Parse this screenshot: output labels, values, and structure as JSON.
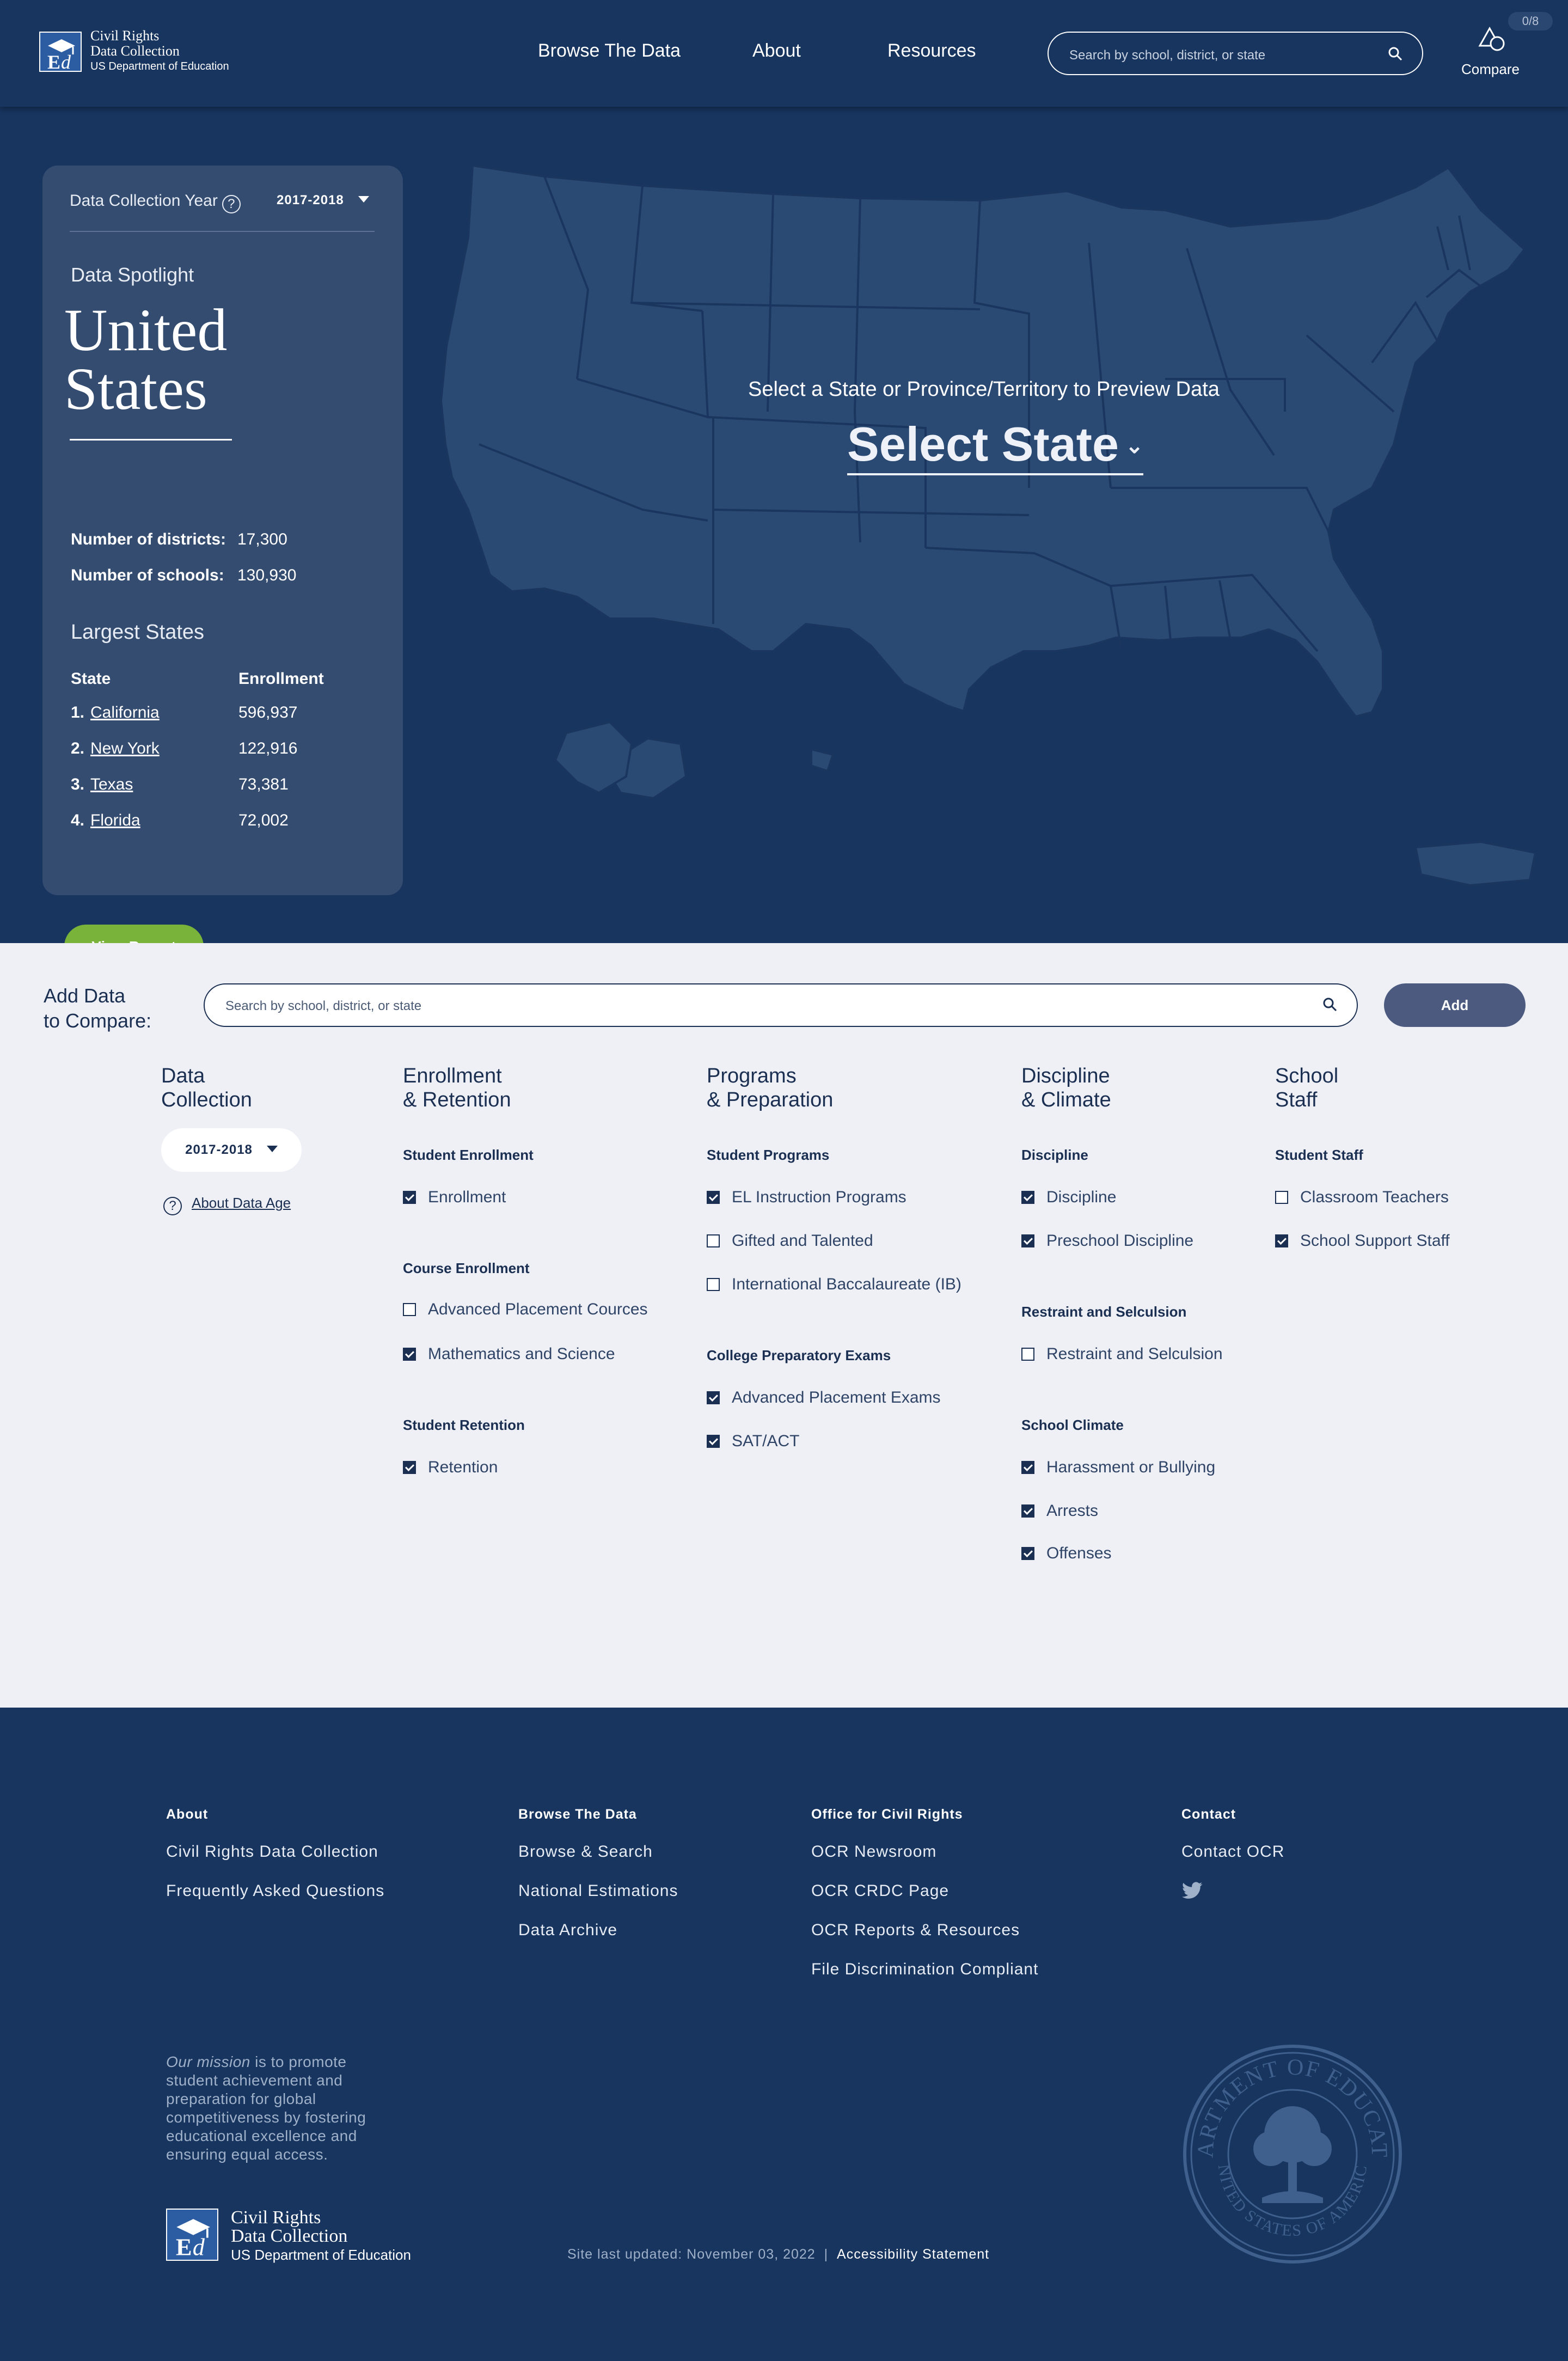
{
  "header": {
    "logo": {
      "line1": "Civil Rights",
      "line2": "Data Collection",
      "line3": "US Department of Education"
    },
    "nav": [
      "Browse The Data",
      "About",
      "Resources"
    ],
    "search_placeholder": "Search by school, district, or state",
    "compare_count": "0/8",
    "compare_label": "Compare"
  },
  "spotlight": {
    "year_label": "Data Collection Year",
    "year_value": "2017-2018",
    "section_label": "Data Spotlight",
    "title_line1": "United",
    "title_line2": "States",
    "stats": [
      {
        "label": "Number of districts:",
        "value": "17,300"
      },
      {
        "label": "Number of schools:",
        "value": "130,930"
      }
    ],
    "largest_label": "Largest States",
    "col_state": "State",
    "col_enrollment": "Enrollment",
    "rows": [
      {
        "rank": "1.",
        "state": "California",
        "enrollment": "596,937"
      },
      {
        "rank": "2.",
        "state": "New York",
        "enrollment": "122,916"
      },
      {
        "rank": "3.",
        "state": "Texas",
        "enrollment": "73,381"
      },
      {
        "rank": "4.",
        "state": "Florida",
        "enrollment": "72,002"
      }
    ],
    "view_button": "View Report"
  },
  "map": {
    "prompt": "Select a State or Province/Territory to Preview Data",
    "select_label": "Select State"
  },
  "compare": {
    "title_line1": "Add Data",
    "title_line2": "to Compare:",
    "search_placeholder": "Search by school, district, or state",
    "add_button": "Add",
    "data_collection": {
      "head1": "Data",
      "head2": "Collection",
      "year": "2017-2018",
      "about_link": "About Data Age"
    },
    "enrollment": {
      "head1": "Enrollment",
      "head2": "& Retention",
      "groups": [
        {
          "title": "Student Enrollment",
          "items": [
            {
              "label": "Enrollment",
              "checked": true
            }
          ]
        },
        {
          "title": "Course Enrollment",
          "items": [
            {
              "label": "Advanced Placement Cources",
              "checked": false
            },
            {
              "label": "Mathematics and Science",
              "checked": true
            }
          ]
        },
        {
          "title": "Student Retention",
          "items": [
            {
              "label": "Retention",
              "checked": true
            }
          ]
        }
      ]
    },
    "programs": {
      "head1": "Programs",
      "head2": "& Preparation",
      "groups": [
        {
          "title": "Student Programs",
          "items": [
            {
              "label": "EL Instruction Programs",
              "checked": true
            },
            {
              "label": "Gifted and Talented",
              "checked": false
            },
            {
              "label": "International Baccalaureate (IB)",
              "checked": false
            }
          ]
        },
        {
          "title": "College Preparatory Exams",
          "items": [
            {
              "label": "Advanced Placement Exams",
              "checked": true
            },
            {
              "label": "SAT/ACT",
              "checked": true
            }
          ]
        }
      ]
    },
    "discipline": {
      "head1": "Discipline",
      "head2": "& Climate",
      "groups": [
        {
          "title": "Discipline",
          "items": [
            {
              "label": "Discipline",
              "checked": true
            },
            {
              "label": "Preschool Discipline",
              "checked": true
            }
          ]
        },
        {
          "title": "Restraint and Selculsion",
          "items": [
            {
              "label": "Restraint and Selculsion",
              "checked": false
            }
          ]
        },
        {
          "title": "School Climate",
          "items": [
            {
              "label": "Harassment or Bullying",
              "checked": true
            },
            {
              "label": "Arrests",
              "checked": true
            },
            {
              "label": "Offenses",
              "checked": true
            }
          ]
        }
      ]
    },
    "staff": {
      "head1": "School",
      "head2": "Staff",
      "groups": [
        {
          "title": "Student Staff",
          "items": [
            {
              "label": "Classroom Teachers",
              "checked": false
            },
            {
              "label": "School Support Staff",
              "checked": true
            }
          ]
        }
      ]
    }
  },
  "footer": {
    "about": {
      "head": "About",
      "links": [
        "Civil Rights Data Collection",
        "Frequently Asked Questions"
      ]
    },
    "browse": {
      "head": "Browse The Data",
      "links": [
        "Browse & Search",
        "National Estimations",
        "Data Archive"
      ]
    },
    "ocr": {
      "head": "Office for Civil Rights",
      "links": [
        "OCR Newsroom",
        "OCR CRDC Page",
        "OCR Reports & Resources",
        "File Discrimination Compliant"
      ]
    },
    "contact": {
      "head": "Contact",
      "links": [
        "Contact OCR"
      ]
    },
    "mission_lead": "Our mission",
    "mission_rest": " is to promote student achievement and preparation for global competitiveness by fostering educational excellence and ensuring equal access.",
    "logo": {
      "line1": "Civil Rights",
      "line2": "Data Collection",
      "line3": "US Department of Education"
    },
    "updated": "Site last updated: November 03, 2022",
    "separator": "|",
    "accessibility": "Accessibility Statement",
    "seal_top": "DEPARTMENT OF EDUCATION",
    "seal_bottom": "UNITED STATES OF AMERICA"
  },
  "colors": {
    "navy": "#17355f",
    "panel": "#354c71",
    "green": "#7ab33a",
    "map_fill": "#2a4a74",
    "light_bg": "#eef0f5"
  }
}
